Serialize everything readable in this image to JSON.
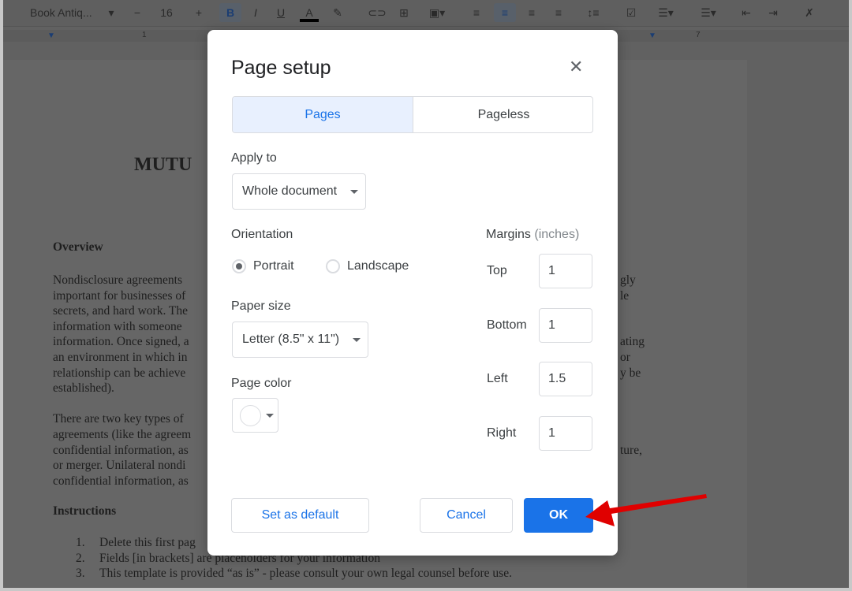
{
  "toolbar": {
    "font": "Book Antiq...",
    "font_size": "16",
    "minus": "−",
    "plus": "+",
    "bold": "B",
    "italic": "I",
    "underline": "U",
    "text_color": "A"
  },
  "ruler": {
    "mark1": "1",
    "mark7": "7"
  },
  "document": {
    "title_fragment": "MUTU",
    "heading_overview": "Overview",
    "left_lines": [
      "Nondisclosure agreements",
      "important for businesses of",
      "secrets, and hard work. The",
      "information with someone",
      "information. Once signed, a",
      "an environment in which in",
      "relationship can be achieve",
      "established).",
      "",
      "There are two key types of",
      "agreements (like the agreem",
      "confidential information, as",
      "or merger. Unilateral nondi",
      "confidential information, as"
    ],
    "right_lines": [
      "gly",
      "le",
      "",
      "",
      "ating",
      "or",
      "y be",
      "",
      "",
      "",
      "",
      "ture,",
      "",
      ""
    ],
    "heading_instructions": "Instructions",
    "list": [
      {
        "n": "1.",
        "t": "Delete this first pag"
      },
      {
        "n": "2.",
        "t": "Fields [in brackets] are placeholders for your information"
      },
      {
        "n": "3.",
        "t": "This template is provided “as is” - please consult your own legal counsel before use."
      }
    ]
  },
  "dialog": {
    "title": "Page setup",
    "close_icon": "close-icon",
    "tabs": [
      {
        "label": "Pages",
        "selected": true
      },
      {
        "label": "Pageless",
        "selected": false
      }
    ],
    "apply_to_label": "Apply to",
    "apply_to_value": "Whole document",
    "orientation_label": "Orientation",
    "portrait": "Portrait",
    "landscape": "Landscape",
    "orientation_selected": "Portrait",
    "paper_size_label": "Paper size",
    "paper_size_value": "Letter (8.5\" x 11\")",
    "page_color_label": "Page color",
    "page_color": "#ffffff",
    "margins_label": "Margins",
    "margins_unit": "(inches)",
    "margins": [
      {
        "label": "Top",
        "value": "1"
      },
      {
        "label": "Bottom",
        "value": "1"
      },
      {
        "label": "Left",
        "value": "1.5"
      },
      {
        "label": "Right",
        "value": "1"
      }
    ],
    "set_default": "Set as default",
    "cancel": "Cancel",
    "ok": "OK"
  },
  "colors": {
    "accent": "#1a73e8",
    "tab_selected_bg": "#e8f0fe",
    "arrow": "#e00000"
  }
}
